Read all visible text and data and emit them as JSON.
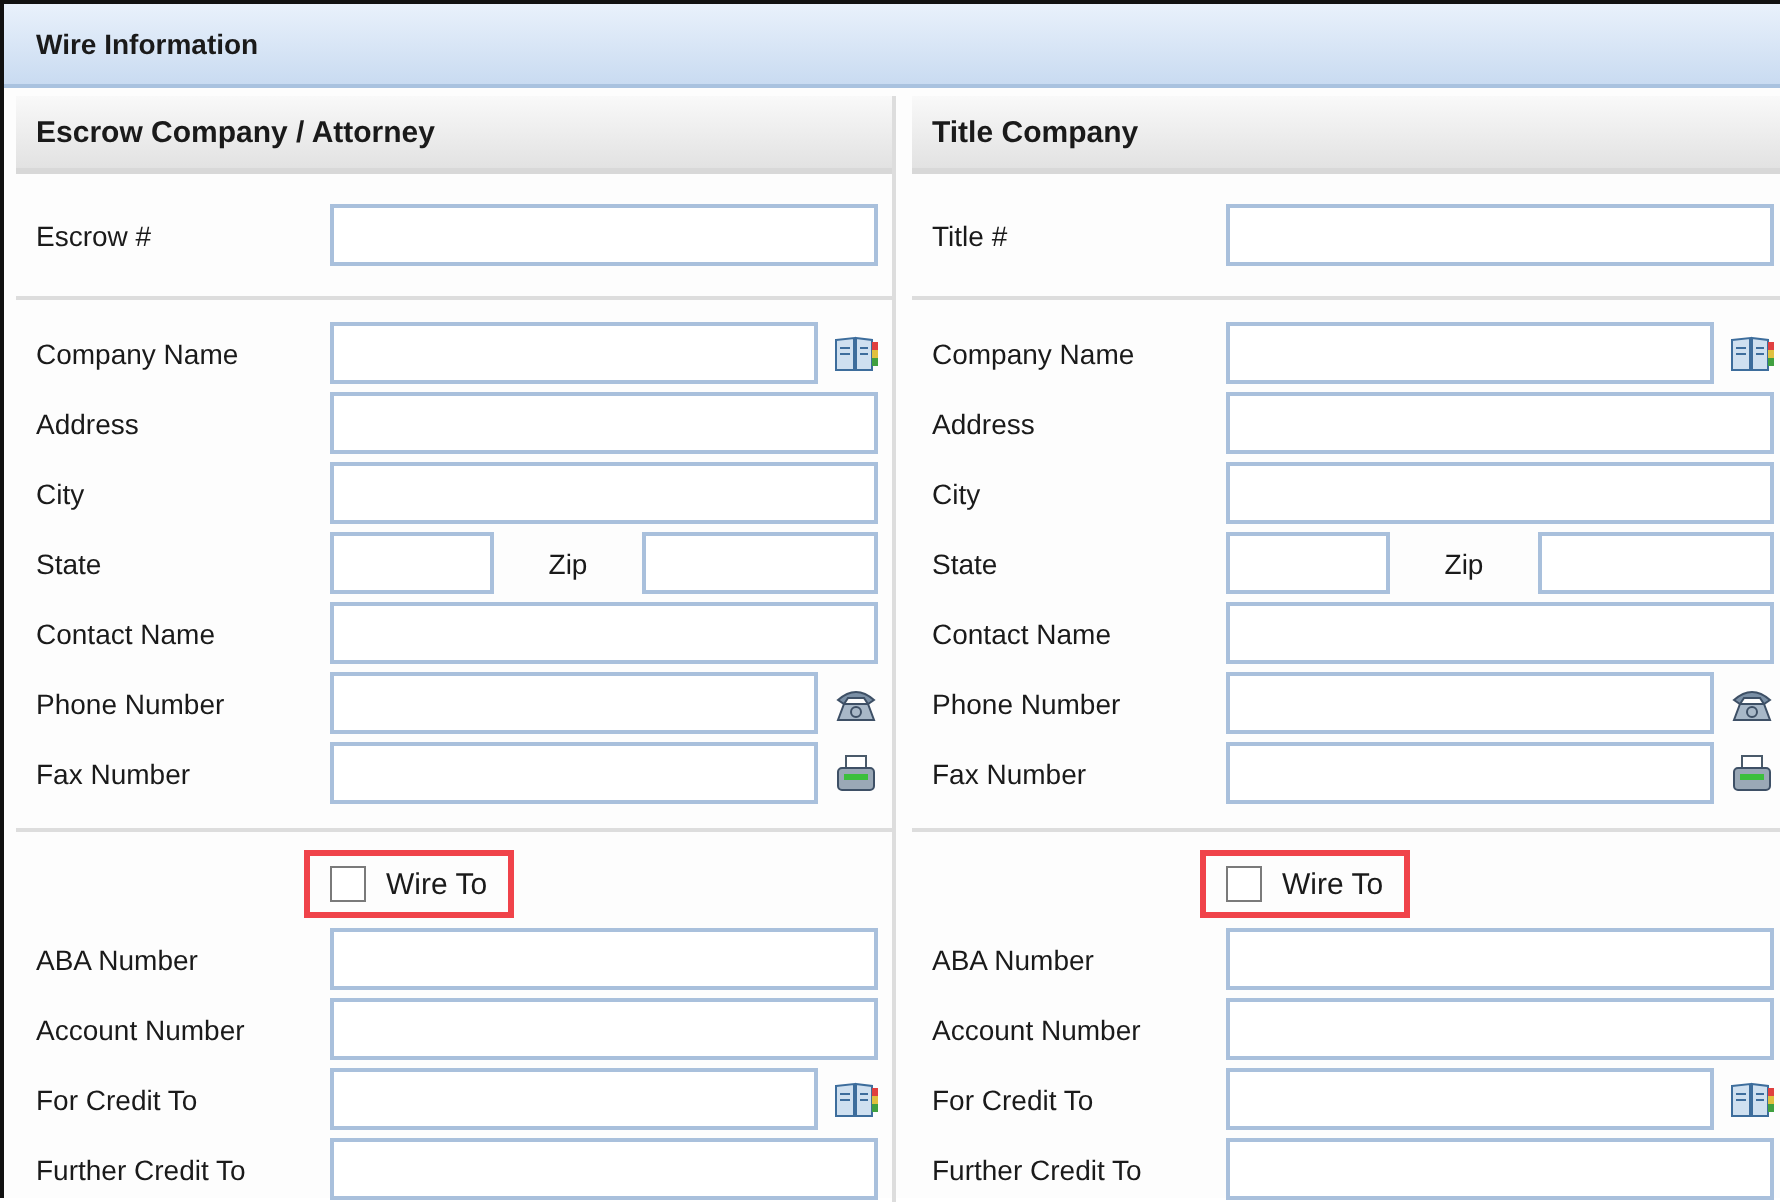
{
  "panel": {
    "title": "Wire Information"
  },
  "columns": [
    {
      "title": "Escrow Company / Attorney",
      "number_label": "Escrow #",
      "fields": [
        {
          "kind": "book",
          "label": "Company Name"
        },
        {
          "kind": "text",
          "label": "Address"
        },
        {
          "kind": "text",
          "label": "City"
        },
        {
          "kind": "state_zip",
          "label": "State",
          "label_2": "Zip"
        },
        {
          "kind": "text",
          "label": "Contact Name"
        },
        {
          "kind": "phone",
          "label": "Phone Number"
        },
        {
          "kind": "fax",
          "label": "Fax Number"
        }
      ],
      "wire_to": {
        "label": "Wire To",
        "checked": false,
        "highlighted": true
      },
      "bank_fields": [
        {
          "kind": "text",
          "label": "ABA Number"
        },
        {
          "kind": "text",
          "label": "Account Number"
        },
        {
          "kind": "book",
          "label": "For Credit To"
        },
        {
          "kind": "text",
          "label": "Further Credit To"
        }
      ]
    },
    {
      "title": "Title Company",
      "number_label": "Title #",
      "fields": [
        {
          "kind": "book",
          "label": "Company Name"
        },
        {
          "kind": "text",
          "label": "Address"
        },
        {
          "kind": "text",
          "label": "City"
        },
        {
          "kind": "state_zip",
          "label": "State",
          "label_2": "Zip"
        },
        {
          "kind": "text",
          "label": "Contact Name"
        },
        {
          "kind": "phone",
          "label": "Phone Number"
        },
        {
          "kind": "fax",
          "label": "Fax Number"
        }
      ],
      "wire_to": {
        "label": "Wire To",
        "checked": false,
        "highlighted": true
      },
      "bank_fields": [
        {
          "kind": "text",
          "label": "ABA Number"
        },
        {
          "kind": "text",
          "label": "Account Number"
        },
        {
          "kind": "book",
          "label": "For Credit To"
        },
        {
          "kind": "text",
          "label": "Further Credit To"
        }
      ]
    }
  ]
}
